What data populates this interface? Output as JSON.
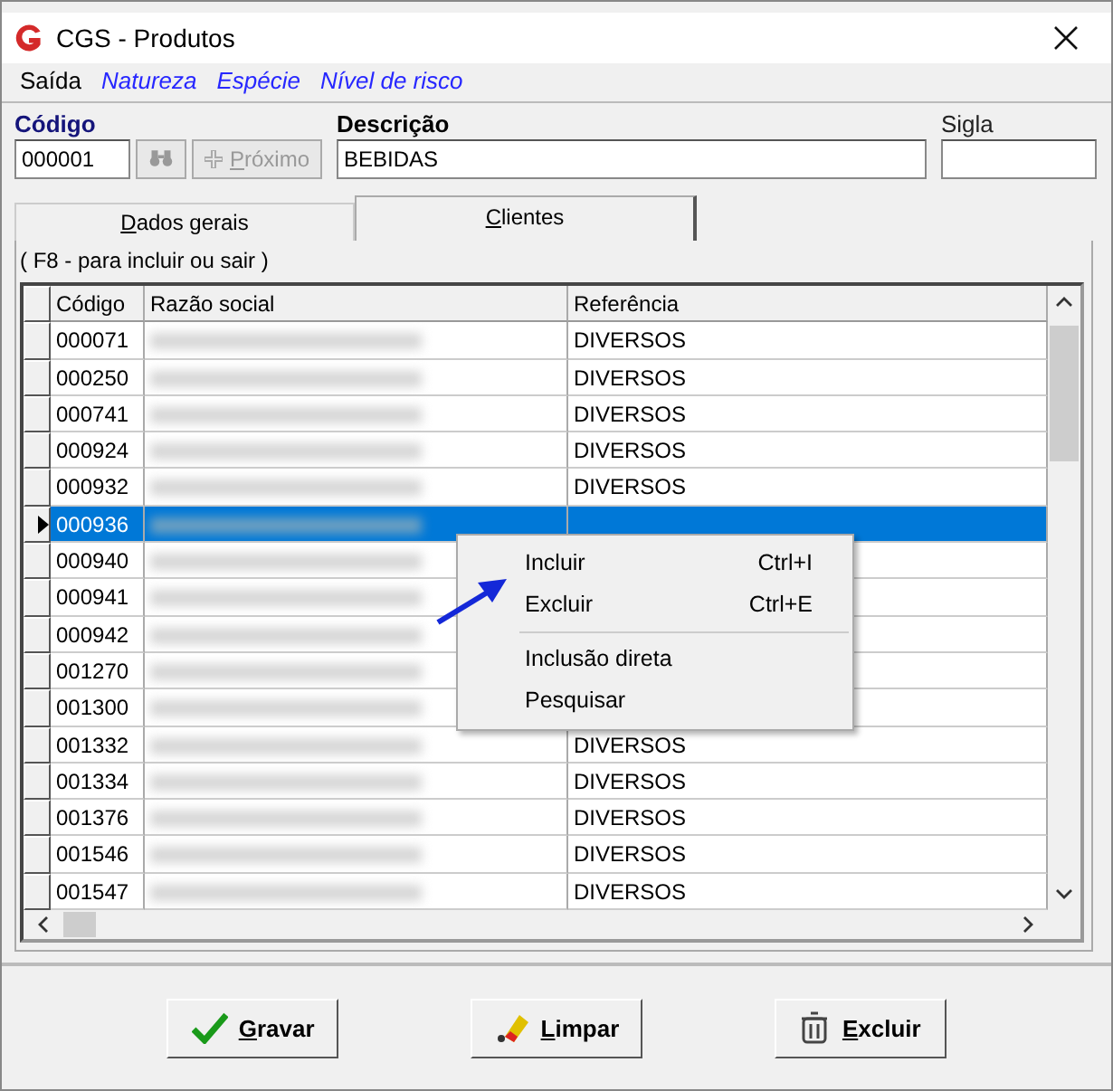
{
  "window": {
    "title": "CGS - Produtos"
  },
  "menu": [
    {
      "label": "Saída",
      "kind": "plain"
    },
    {
      "label": "Natureza",
      "kind": "link"
    },
    {
      "label": "Espécie",
      "kind": "link"
    },
    {
      "label": "Nível de risco",
      "kind": "link"
    }
  ],
  "fields": {
    "codigo": {
      "label": "Código",
      "value": "000001"
    },
    "proximo": {
      "label": "Próximo",
      "disabled": true
    },
    "descricao": {
      "label": "Descrição",
      "value": "BEBIDAS"
    },
    "sigla": {
      "label": "Sigla"
    }
  },
  "tabs": [
    {
      "label": "Dados gerais",
      "selected": false
    },
    {
      "label": "Clientes",
      "selected": true
    }
  ],
  "hint": "( F8 - para incluir ou sair )",
  "table": {
    "columns": [
      "Código",
      "Razão social",
      "Referência"
    ],
    "rows": [
      {
        "codigo": "000071",
        "referencia": "DIVERSOS",
        "selected": false
      },
      {
        "codigo": "000250",
        "referencia": "DIVERSOS",
        "selected": false
      },
      {
        "codigo": "000741",
        "referencia": "DIVERSOS",
        "selected": false
      },
      {
        "codigo": "000924",
        "referencia": "DIVERSOS",
        "selected": false
      },
      {
        "codigo": "000932",
        "referencia": "DIVERSOS",
        "selected": false
      },
      {
        "codigo": "000936",
        "selected": true
      },
      {
        "codigo": "000940",
        "selected": false
      },
      {
        "codigo": "000941",
        "selected": false
      },
      {
        "codigo": "000942",
        "selected": false
      },
      {
        "codigo": "001270",
        "selected": false
      },
      {
        "codigo": "001300",
        "selected": false
      },
      {
        "codigo": "001332",
        "referencia": "DIVERSOS",
        "selected": false
      },
      {
        "codigo": "001334",
        "referencia": "DIVERSOS",
        "selected": false
      },
      {
        "codigo": "001376",
        "referencia": "DIVERSOS",
        "selected": false
      },
      {
        "codigo": "001546",
        "referencia": "DIVERSOS",
        "selected": false
      },
      {
        "codigo": "001547",
        "referencia": "DIVERSOS",
        "selected": false
      }
    ]
  },
  "context_menu": [
    {
      "label": "Incluir",
      "shortcut": "Ctrl+I"
    },
    {
      "label": "Excluir",
      "shortcut": "Ctrl+E",
      "separator_after": true
    },
    {
      "label": "Inclusão direta"
    },
    {
      "label": "Pesquisar"
    }
  ],
  "buttons": [
    {
      "label": "Gravar",
      "kind": "save"
    },
    {
      "label": "Limpar",
      "kind": "clear"
    },
    {
      "label": "Excluir",
      "kind": "delete"
    }
  ]
}
